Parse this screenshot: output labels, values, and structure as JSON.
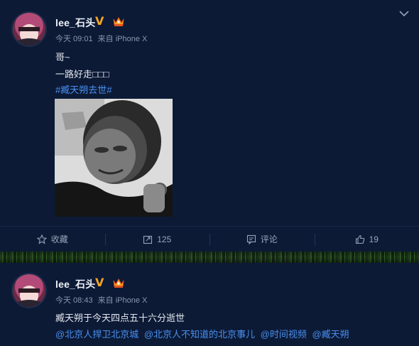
{
  "posts": [
    {
      "username": "lee_石头",
      "time": "今天 09:01",
      "source": "来自 iPhone X",
      "lines": [
        "哥~",
        "一路好走□□□"
      ],
      "topic": "#臧天朔去世#",
      "actions": {
        "favorite_label": "收藏",
        "repost_count": "125",
        "comment_label": "评论",
        "like_count": "19"
      }
    },
    {
      "username": "lee_石头",
      "time": "今天 08:43",
      "source": "来自 iPhone X",
      "lines": [
        "臧天朔于今天四点五十六分逝世"
      ],
      "mentions": [
        "@北京人捍卫北京城",
        "@北京人不知道的北京事儿",
        "@时间视频",
        "@臧天朔"
      ]
    }
  ],
  "icons": {
    "verified": "v-badge-icon",
    "member": "crown-icon",
    "more": "chevron-down-icon",
    "favorite": "star-icon",
    "repost": "repost-icon",
    "comment": "comment-icon",
    "like": "thumbs-up-icon"
  },
  "colors": {
    "background": "#0c1a36",
    "link": "#4a90f0",
    "verified": "#f6a623"
  }
}
